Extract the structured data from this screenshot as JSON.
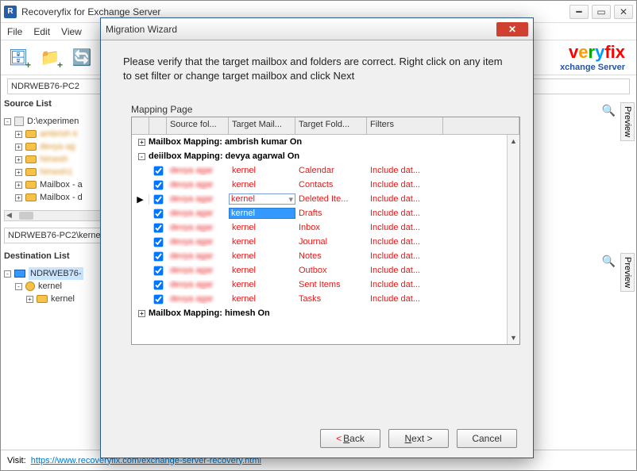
{
  "app": {
    "title": "Recoveryfix for Exchange Server"
  },
  "menu": {
    "file": "File",
    "edit": "Edit",
    "view": "View"
  },
  "brand": {
    "line1a": "very",
    "line1b": "fix",
    "line2": "xchange Server"
  },
  "breadcrumb": {
    "text": "NDRWEB76-PC2"
  },
  "breadcrumb2": {
    "text": "NDRWEB76-PC2\\kerne"
  },
  "sourceList": {
    "title": "Source List",
    "root": "D:\\experimen",
    "items": [
      "ambrish k",
      "devya ag",
      "himesh",
      "himesh1",
      "Mailbox - a",
      "Mailbox - d"
    ]
  },
  "destList": {
    "title": "Destination List",
    "root": "NDRWEB76-",
    "child": "kernel",
    "grandchild": "kernel"
  },
  "status": {
    "label": "Visit:",
    "url": "https://www.recoveryfix.com/exchange-server-recovery.html"
  },
  "preview": {
    "label": "Preview"
  },
  "search": {
    "placeholder": ""
  },
  "dialog": {
    "title": "Migration Wizard",
    "message": "Please verify that the target mailbox and folders are correct. Right click on any item to set filter or change target mailbox and click Next",
    "mappingLabel": "Mapping Page",
    "columns": {
      "source": "Source fol...",
      "targetMail": "Target Mail...",
      "targetFold": "Target Fold...",
      "filters": "Filters"
    },
    "groups": [
      {
        "exp": "+",
        "label": "Mailbox Mapping: ambrish kumar  On"
      },
      {
        "exp": "-",
        "label": "deiilbox Mapping: devya agarwal  On"
      },
      {
        "exp": "+",
        "label": "Mailbox Mapping: himesh  On"
      }
    ],
    "rows": [
      {
        "src": "devya agar",
        "tgt": "kernel",
        "fold": "Calendar",
        "flt": "Include dat..."
      },
      {
        "src": "devya agar",
        "tgt": "kernel",
        "fold": "Contacts",
        "flt": "Include dat..."
      },
      {
        "src": "devya agar",
        "tgt": "kernel",
        "fold": "Deleted Ite...",
        "flt": "Include dat...",
        "rowptr": true,
        "dd": true
      },
      {
        "src": "devya agar",
        "tgt": "kernel",
        "fold": "Drafts",
        "flt": "Include dat...",
        "ddopen": true
      },
      {
        "src": "devya agar",
        "tgt": "kernel",
        "fold": "Inbox",
        "flt": "Include dat..."
      },
      {
        "src": "devya agar",
        "tgt": "kernel",
        "fold": "Journal",
        "flt": "Include dat..."
      },
      {
        "src": "devya agar",
        "tgt": "kernel",
        "fold": "Notes",
        "flt": "Include dat..."
      },
      {
        "src": "devya agar",
        "tgt": "kernel",
        "fold": "Outbox",
        "flt": "Include dat..."
      },
      {
        "src": "devya agar",
        "tgt": "kernel",
        "fold": "Sent Items",
        "flt": "Include dat..."
      },
      {
        "src": "devya agar",
        "tgt": "kernel",
        "fold": "Tasks",
        "flt": "Include dat..."
      }
    ],
    "buttons": {
      "back": "< Back",
      "next": "Next >",
      "cancel": "Cancel"
    }
  }
}
